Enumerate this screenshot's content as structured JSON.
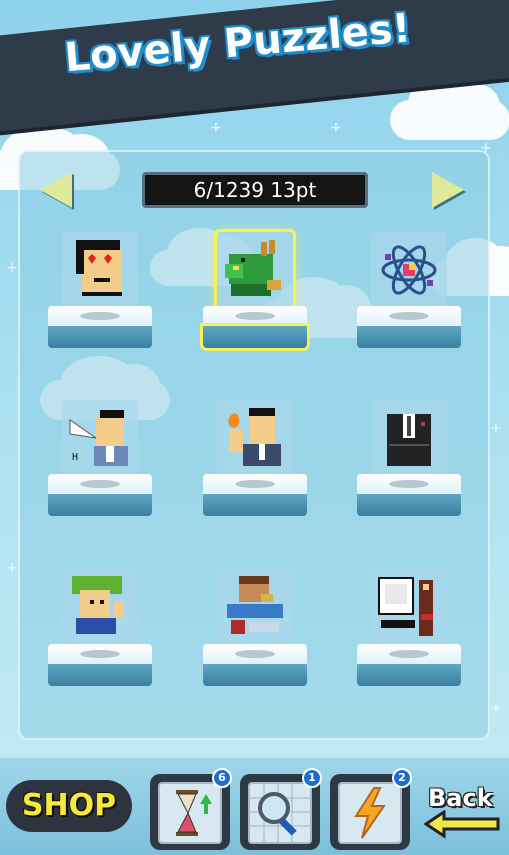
{
  "header": {
    "title": "Lovely Puzzles!"
  },
  "navigation": {
    "counter_text": "6/1239 13pt",
    "prev_icon": "left-arrow-icon",
    "next_icon": "right-arrow-icon"
  },
  "puzzles": [
    {
      "name": "heart-eyes-man-puzzle",
      "selected": false
    },
    {
      "name": "green-dragon-puzzle",
      "selected": true
    },
    {
      "name": "atom-molecule-puzzle",
      "selected": false
    },
    {
      "name": "businessman-side-puzzle",
      "selected": false
    },
    {
      "name": "man-with-flame-puzzle",
      "selected": false
    },
    {
      "name": "suited-man-puzzle",
      "selected": false
    },
    {
      "name": "green-hair-hero-puzzle",
      "selected": false
    },
    {
      "name": "gamer-desk-puzzle",
      "selected": false
    },
    {
      "name": "calendar-sign-puzzle",
      "selected": false
    }
  ],
  "toolbar": {
    "shop_label": "SHOP",
    "items": [
      {
        "name": "hourglass-icon",
        "count": "6"
      },
      {
        "name": "magnifier-icon",
        "count": "1"
      },
      {
        "name": "lightning-icon",
        "count": "2"
      }
    ],
    "back_label": "Back",
    "back_icon": "back-arrow-icon"
  },
  "colors": {
    "highlight": "#f3f25a",
    "shop_text": "#f6e93a",
    "banner": "#2f3b48",
    "badge": "#1c6fd0"
  }
}
